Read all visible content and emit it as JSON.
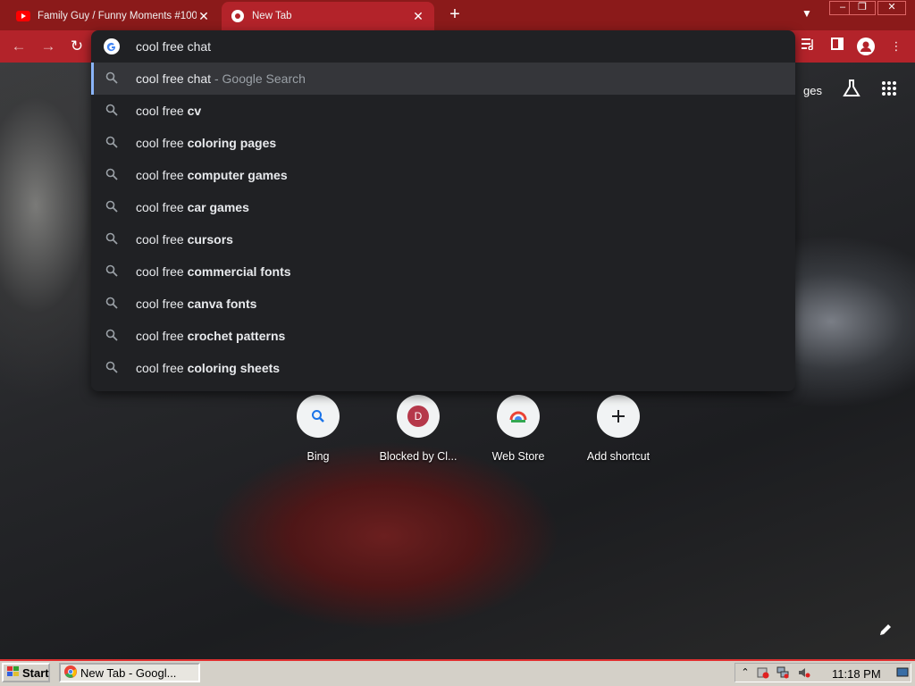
{
  "tabs": [
    {
      "title": "Family Guy / Funny Moments #100",
      "icon": "youtube-icon",
      "active": false
    },
    {
      "title": "New Tab",
      "icon": "chrome-icon",
      "active": true
    }
  ],
  "window_controls": {
    "minimize": "–",
    "restore": "❐",
    "close": "✕"
  },
  "toolbar": {
    "back": "←",
    "forward": "→",
    "reload": "↻"
  },
  "omnibox": {
    "value": "cool free chat",
    "suggestions": [
      {
        "prefix": "cool free chat",
        "suffix": "",
        "separator": " - ",
        "source": "Google Search",
        "selected": true
      },
      {
        "prefix": "cool free ",
        "suffix": "cv"
      },
      {
        "prefix": "cool free ",
        "suffix": "coloring pages"
      },
      {
        "prefix": "cool free ",
        "suffix": "computer games"
      },
      {
        "prefix": "cool free ",
        "suffix": "car games"
      },
      {
        "prefix": "cool free ",
        "suffix": "cursors"
      },
      {
        "prefix": "cool free ",
        "suffix": "commercial fonts"
      },
      {
        "prefix": "cool free ",
        "suffix": "canva fonts"
      },
      {
        "prefix": "cool free ",
        "suffix": "crochet patterns"
      },
      {
        "prefix": "cool free ",
        "suffix": "coloring sheets"
      }
    ]
  },
  "page": {
    "images_link_partial": "ges",
    "shortcuts": [
      {
        "label": "Bing",
        "icon": "search-icon"
      },
      {
        "label": "Blocked by Cl...",
        "icon": "letter-d-icon",
        "letter": "D"
      },
      {
        "label": "Web Store",
        "icon": "chrome-web-store-icon"
      },
      {
        "label": "Add shortcut",
        "icon": "plus-icon"
      }
    ]
  },
  "taskbar": {
    "start_label": "Start",
    "task_label": "New Tab - Googl...",
    "clock": "11:18 PM"
  },
  "colors": {
    "tabstrip": "#8b1a1a",
    "toolbar": "#b3232a",
    "omnibox_bg": "#202124",
    "selected_accent": "#8ab4f8"
  }
}
